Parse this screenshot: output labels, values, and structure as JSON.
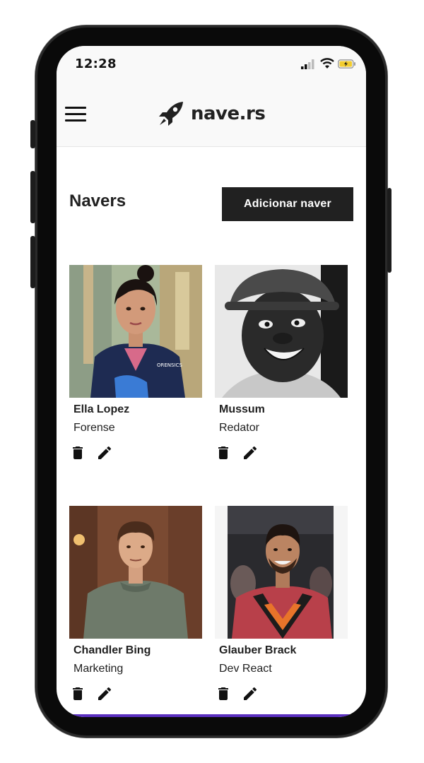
{
  "status_bar": {
    "time": "12:28"
  },
  "header": {
    "logo_text": "nave.rs",
    "menu_icon": "hamburger-menu-icon",
    "logo_icon": "rocket-icon"
  },
  "page": {
    "title": "Navers",
    "add_button_label": "Adicionar naver"
  },
  "navers": [
    {
      "name": "Ella Lopez",
      "role": "Forense",
      "photo": "portrait-woman-blue-jacket"
    },
    {
      "name": "Mussum",
      "role": "Redator",
      "photo": "portrait-man-hat-bw"
    },
    {
      "name": "Chandler Bing",
      "role": "Marketing",
      "photo": "portrait-man-gray-sweater"
    },
    {
      "name": "Glauber Brack",
      "role": "Dev React",
      "photo": "portrait-man-smiling-party"
    }
  ],
  "colors": {
    "primary": "#212121",
    "background": "#ffffff",
    "header_bg": "#f9f9f9",
    "accent_bottom": "#5a2fbf"
  }
}
